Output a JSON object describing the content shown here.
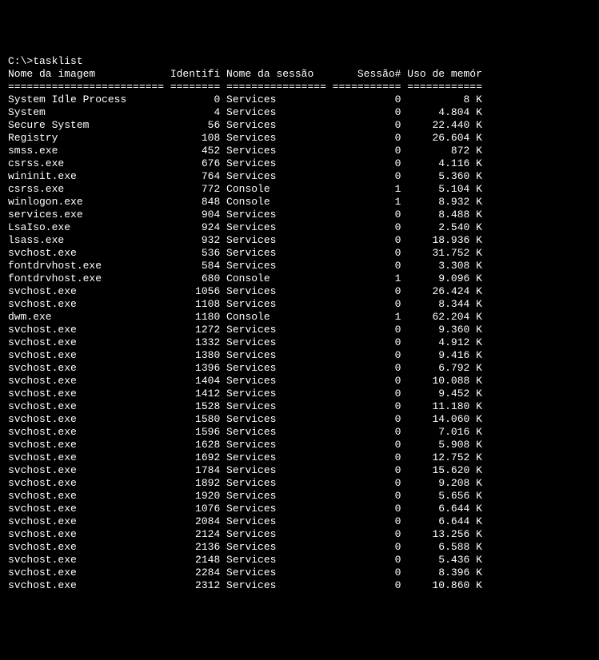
{
  "prompt": "C:\\>tasklist",
  "headers": {
    "image": "Nome da imagem",
    "pid": "Identifi",
    "session_name": "Nome da sessão",
    "session_num": "Sessão#",
    "mem": "Uso de memór"
  },
  "separator": "========================= ======== ================ =========== ============",
  "rows": [
    {
      "image": "System Idle Process",
      "pid": "0",
      "session_name": "Services",
      "session_num": "0",
      "mem": "8 K"
    },
    {
      "image": "System",
      "pid": "4",
      "session_name": "Services",
      "session_num": "0",
      "mem": "4.804 K"
    },
    {
      "image": "Secure System",
      "pid": "56",
      "session_name": "Services",
      "session_num": "0",
      "mem": "22.440 K"
    },
    {
      "image": "Registry",
      "pid": "108",
      "session_name": "Services",
      "session_num": "0",
      "mem": "26.604 K"
    },
    {
      "image": "smss.exe",
      "pid": "452",
      "session_name": "Services",
      "session_num": "0",
      "mem": "872 K"
    },
    {
      "image": "csrss.exe",
      "pid": "676",
      "session_name": "Services",
      "session_num": "0",
      "mem": "4.116 K"
    },
    {
      "image": "wininit.exe",
      "pid": "764",
      "session_name": "Services",
      "session_num": "0",
      "mem": "5.360 K"
    },
    {
      "image": "csrss.exe",
      "pid": "772",
      "session_name": "Console",
      "session_num": "1",
      "mem": "5.104 K"
    },
    {
      "image": "winlogon.exe",
      "pid": "848",
      "session_name": "Console",
      "session_num": "1",
      "mem": "8.932 K"
    },
    {
      "image": "services.exe",
      "pid": "904",
      "session_name": "Services",
      "session_num": "0",
      "mem": "8.488 K"
    },
    {
      "image": "LsaIso.exe",
      "pid": "924",
      "session_name": "Services",
      "session_num": "0",
      "mem": "2.540 K"
    },
    {
      "image": "lsass.exe",
      "pid": "932",
      "session_name": "Services",
      "session_num": "0",
      "mem": "18.936 K"
    },
    {
      "image": "svchost.exe",
      "pid": "536",
      "session_name": "Services",
      "session_num": "0",
      "mem": "31.752 K"
    },
    {
      "image": "fontdrvhost.exe",
      "pid": "584",
      "session_name": "Services",
      "session_num": "0",
      "mem": "3.308 K"
    },
    {
      "image": "fontdrvhost.exe",
      "pid": "680",
      "session_name": "Console",
      "session_num": "1",
      "mem": "9.096 K"
    },
    {
      "image": "svchost.exe",
      "pid": "1056",
      "session_name": "Services",
      "session_num": "0",
      "mem": "26.424 K"
    },
    {
      "image": "svchost.exe",
      "pid": "1108",
      "session_name": "Services",
      "session_num": "0",
      "mem": "8.344 K"
    },
    {
      "image": "dwm.exe",
      "pid": "1180",
      "session_name": "Console",
      "session_num": "1",
      "mem": "62.204 K"
    },
    {
      "image": "svchost.exe",
      "pid": "1272",
      "session_name": "Services",
      "session_num": "0",
      "mem": "9.360 K"
    },
    {
      "image": "svchost.exe",
      "pid": "1332",
      "session_name": "Services",
      "session_num": "0",
      "mem": "4.912 K"
    },
    {
      "image": "svchost.exe",
      "pid": "1380",
      "session_name": "Services",
      "session_num": "0",
      "mem": "9.416 K"
    },
    {
      "image": "svchost.exe",
      "pid": "1396",
      "session_name": "Services",
      "session_num": "0",
      "mem": "6.792 K"
    },
    {
      "image": "svchost.exe",
      "pid": "1404",
      "session_name": "Services",
      "session_num": "0",
      "mem": "10.088 K"
    },
    {
      "image": "svchost.exe",
      "pid": "1412",
      "session_name": "Services",
      "session_num": "0",
      "mem": "9.452 K"
    },
    {
      "image": "svchost.exe",
      "pid": "1528",
      "session_name": "Services",
      "session_num": "0",
      "mem": "11.180 K"
    },
    {
      "image": "svchost.exe",
      "pid": "1580",
      "session_name": "Services",
      "session_num": "0",
      "mem": "14.060 K"
    },
    {
      "image": "svchost.exe",
      "pid": "1596",
      "session_name": "Services",
      "session_num": "0",
      "mem": "7.016 K"
    },
    {
      "image": "svchost.exe",
      "pid": "1628",
      "session_name": "Services",
      "session_num": "0",
      "mem": "5.908 K"
    },
    {
      "image": "svchost.exe",
      "pid": "1692",
      "session_name": "Services",
      "session_num": "0",
      "mem": "12.752 K"
    },
    {
      "image": "svchost.exe",
      "pid": "1784",
      "session_name": "Services",
      "session_num": "0",
      "mem": "15.620 K"
    },
    {
      "image": "svchost.exe",
      "pid": "1892",
      "session_name": "Services",
      "session_num": "0",
      "mem": "9.208 K"
    },
    {
      "image": "svchost.exe",
      "pid": "1920",
      "session_name": "Services",
      "session_num": "0",
      "mem": "5.656 K"
    },
    {
      "image": "svchost.exe",
      "pid": "1076",
      "session_name": "Services",
      "session_num": "0",
      "mem": "6.644 K"
    },
    {
      "image": "svchost.exe",
      "pid": "2084",
      "session_name": "Services",
      "session_num": "0",
      "mem": "6.644 K"
    },
    {
      "image": "svchost.exe",
      "pid": "2124",
      "session_name": "Services",
      "session_num": "0",
      "mem": "13.256 K"
    },
    {
      "image": "svchost.exe",
      "pid": "2136",
      "session_name": "Services",
      "session_num": "0",
      "mem": "6.588 K"
    },
    {
      "image": "svchost.exe",
      "pid": "2148",
      "session_name": "Services",
      "session_num": "0",
      "mem": "5.436 K"
    },
    {
      "image": "svchost.exe",
      "pid": "2284",
      "session_name": "Services",
      "session_num": "0",
      "mem": "8.396 K"
    },
    {
      "image": "svchost.exe",
      "pid": "2312",
      "session_name": "Services",
      "session_num": "0",
      "mem": "10.860 K"
    }
  ]
}
